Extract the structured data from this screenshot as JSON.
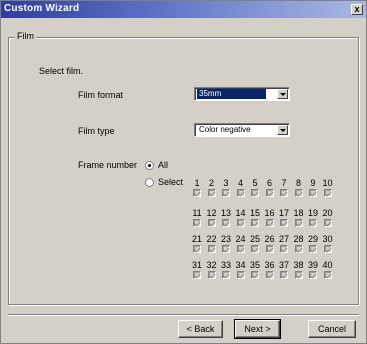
{
  "window": {
    "title": "Custom Wizard",
    "close_label": "x"
  },
  "group": {
    "label": "Film"
  },
  "instructions": "Select film.",
  "film_format": {
    "label": "Film format",
    "value": "35mm"
  },
  "film_type": {
    "label": "Film type",
    "value": "Color negative"
  },
  "frame_number": {
    "label": "Frame number",
    "options": [
      {
        "label": "All",
        "selected": true
      },
      {
        "label": "Select",
        "selected": false
      }
    ],
    "rows": [
      {
        "numbers": [
          "1",
          "2",
          "3",
          "4",
          "5",
          "6",
          "7",
          "8",
          "9",
          "10"
        ],
        "checked": [
          true,
          true,
          true,
          true,
          true,
          true,
          true,
          true,
          true,
          true
        ]
      },
      {
        "numbers": [
          "11",
          "12",
          "13",
          "14",
          "15",
          "16",
          "17",
          "18",
          "19",
          "20"
        ],
        "checked": [
          true,
          true,
          true,
          true,
          true,
          true,
          true,
          true,
          true,
          true
        ]
      },
      {
        "numbers": [
          "21",
          "22",
          "23",
          "24",
          "25",
          "26",
          "27",
          "28",
          "29",
          "30"
        ],
        "checked": [
          true,
          true,
          true,
          true,
          true,
          true,
          true,
          true,
          true,
          true
        ]
      },
      {
        "numbers": [
          "31",
          "32",
          "33",
          "34",
          "35",
          "36",
          "37",
          "38",
          "39",
          "40"
        ],
        "checked": [
          true,
          true,
          true,
          true,
          true,
          true,
          true,
          true,
          true,
          true
        ]
      }
    ]
  },
  "buttons": {
    "back": "< Back",
    "next": "Next >",
    "cancel": "Cancel"
  },
  "colors": {
    "title_start": "#2f3d9c",
    "title_end": "#a9b8e4",
    "face": "#d4d0c8",
    "selection": "#0a246a"
  }
}
